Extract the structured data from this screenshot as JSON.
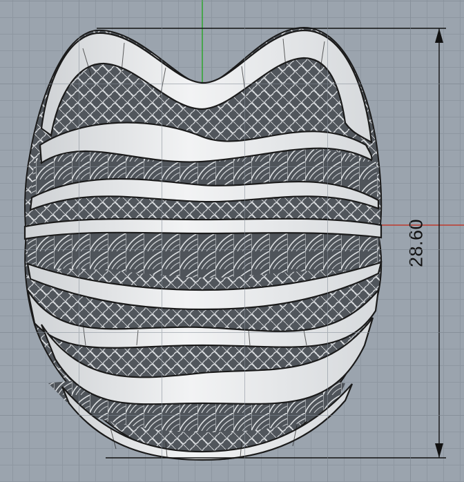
{
  "viewport": {
    "view": "Front",
    "colors": {
      "background": "#9ba4ae",
      "grid_minor": "#8e97a1",
      "grid_major": "#838c96",
      "y_axis": "#2ea52e",
      "x_axis": "#c0392b",
      "model_surface": "#e9ebec",
      "model_edge": "#1a1a1a",
      "lattice": "#5d6166"
    }
  },
  "dimension": {
    "value": "28.60",
    "orientation": "vertical"
  }
}
